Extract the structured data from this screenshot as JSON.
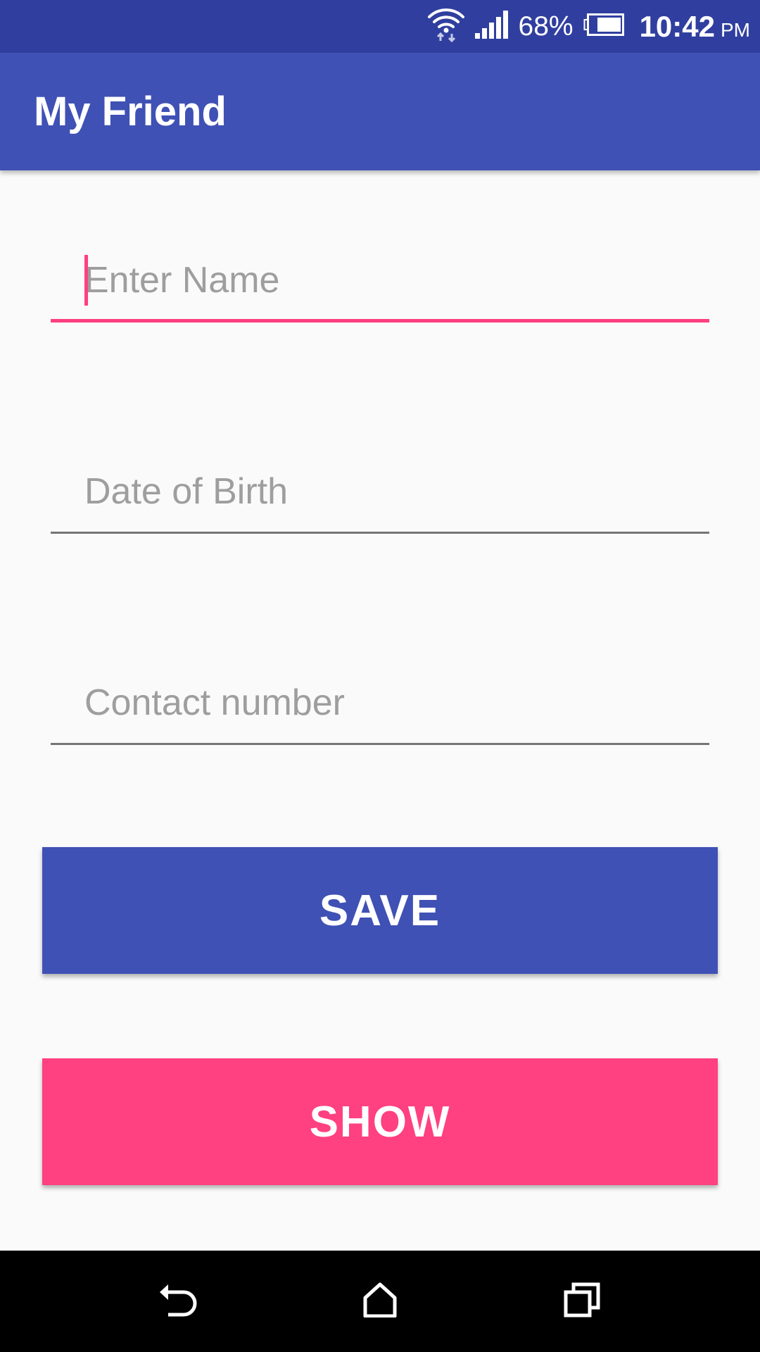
{
  "status_bar": {
    "battery_percent": "68%",
    "time": "10:42",
    "ampm": "PM",
    "icons": [
      "wifi-icon",
      "signal-icon",
      "battery-icon"
    ]
  },
  "app_bar": {
    "title": "My Friend"
  },
  "form": {
    "name_placeholder": "Enter Name",
    "dob_placeholder": "Date of Birth",
    "contact_placeholder": "Contact number"
  },
  "buttons": {
    "save_label": "SAVE",
    "show_label": "SHOW"
  },
  "nav_bar": {
    "icons": [
      "back-icon",
      "home-icon",
      "recents-icon"
    ]
  },
  "colors": {
    "primary": "#3f51b5",
    "primary_dark": "#303f9f",
    "accent": "#ff4081"
  }
}
